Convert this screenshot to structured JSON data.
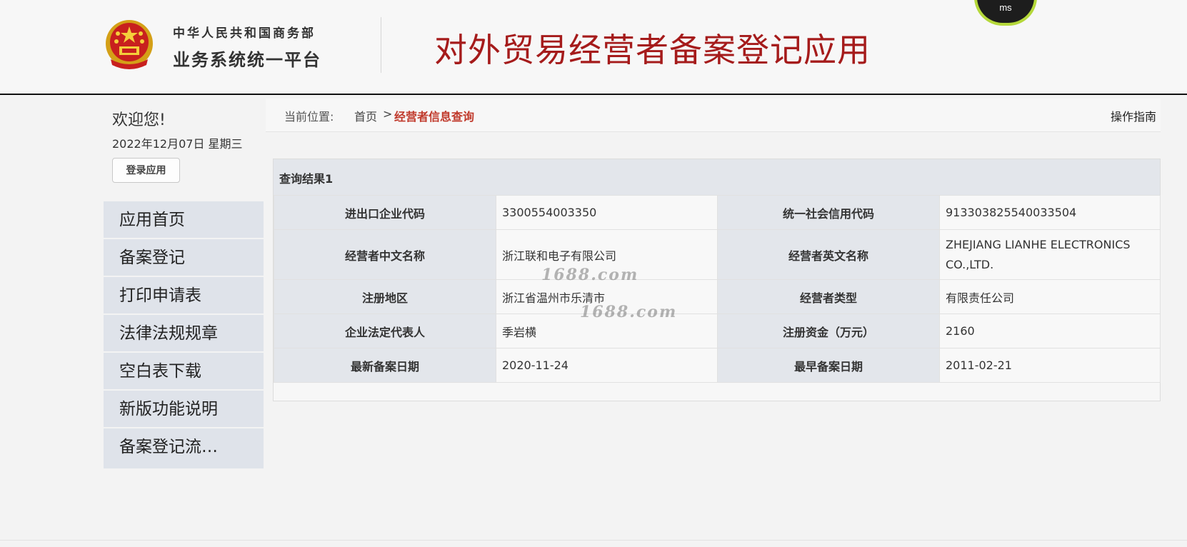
{
  "header": {
    "org_line1": "中华人民共和国商务部",
    "org_line2": "业务系统统一平台",
    "app_title": "对外贸易经营者备案登记应用",
    "gauge_label": "ms"
  },
  "welcome": {
    "title": "欢迎您!",
    "date": "2022年12月07日 星期三",
    "login_label": "登录应用"
  },
  "nav": {
    "items": [
      {
        "label": "应用首页"
      },
      {
        "label": "备案登记"
      },
      {
        "label": "打印申请表"
      },
      {
        "label": "法律法规规章"
      },
      {
        "label": "空白表下载"
      },
      {
        "label": "新版功能说明"
      },
      {
        "label": "备案登记流…"
      }
    ]
  },
  "breadcrumb": {
    "label": "当前位置:",
    "home": "首页",
    "sep": ">",
    "current": "经营者信息查询",
    "guide": "操作指南"
  },
  "result": {
    "title": "查询结果1",
    "rows": [
      {
        "l1": "进出口企业代码",
        "v1": "3300554003350",
        "l2": "统一社会信用代码",
        "v2": "91330382554003350​4"
      },
      {
        "l1": "经营者中文名称",
        "v1": "浙江联和电子有限公司",
        "l2": "经营者英文名称",
        "v2": "ZHEJIANG LIANHE ELECTRONICS CO.,LTD."
      },
      {
        "l1": "注册地区",
        "v1": "浙江省温州市乐清市",
        "l2": "经营者类型",
        "v2": "有限责任公司"
      },
      {
        "l1": "企业法定代表人",
        "v1": "季岩横",
        "l2": "注册资金（万元）",
        "v2": "2160"
      },
      {
        "l1": "最新备案日期",
        "v1": "2020-11-24",
        "l2": "最早备案日期",
        "v2": "2011-02-21"
      }
    ]
  },
  "watermarks": [
    "1688.com",
    "1688.com"
  ],
  "colors": {
    "title_red": "#a51b1b",
    "crumb_red": "#c0392b",
    "nav_bg": "#dfe3ea",
    "gauge_ring": "#b5d83a"
  },
  "icons": {
    "emblem": "national-emblem-icon"
  }
}
